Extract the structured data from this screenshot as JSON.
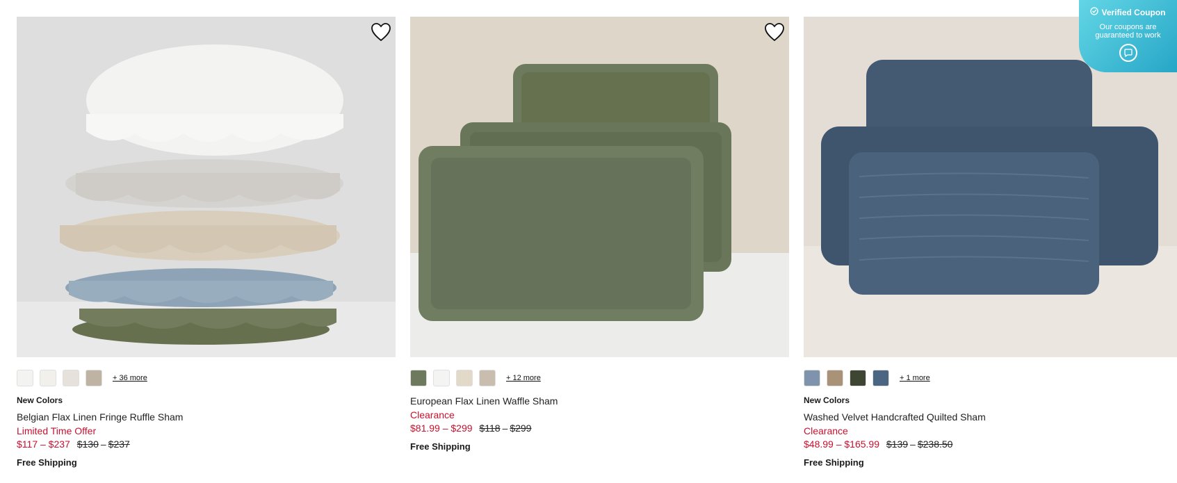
{
  "products": [
    {
      "swatches": [
        "#f3f3f1",
        "#f2f0ea",
        "#e6e1da",
        "#bfb3a4"
      ],
      "more": "+ 36 more",
      "badge": "New Colors",
      "name": "Belgian Flax Linen Fringe Ruffle Sham",
      "promo": "Limited Time Offer",
      "price": "$117 – $237",
      "old_low": "$130",
      "old_high": "$237",
      "shipping": "Free Shipping",
      "image": "stacked-ruffle-pillows"
    },
    {
      "swatches": [
        "#6d7a5e",
        "#f4f4f2",
        "#e3d9c8",
        "#c8bdae"
      ],
      "more": "+ 12 more",
      "badge": "",
      "name": "European Flax Linen Waffle Sham",
      "promo": "Clearance",
      "price": "$81.99 – $299",
      "old_low": "$118",
      "old_high": "$299",
      "shipping": "Free Shipping",
      "image": "green-waffle-pillows"
    },
    {
      "swatches": [
        "#7f93ad",
        "#a99278",
        "#3f4533",
        "#4a6683"
      ],
      "more": "+ 1 more",
      "badge": "New Colors",
      "name": "Washed Velvet Handcrafted Quilted Sham",
      "promo": "Clearance",
      "price": "$48.99 – $165.99",
      "old_low": "$139",
      "old_high": "$238.50",
      "shipping": "Free Shipping",
      "image": "blue-velvet-pillows"
    }
  ],
  "coupon": {
    "title": "Verified Coupon",
    "subtitle": "Our coupons are guaranteed to work"
  },
  "colors": {
    "sale_red": "#c8102e",
    "coupon_teal": "#3bbad6"
  },
  "icons": {
    "favorite": "heart-outline-icon",
    "coupon_check": "check-circle-icon",
    "chat": "chat-icon"
  }
}
